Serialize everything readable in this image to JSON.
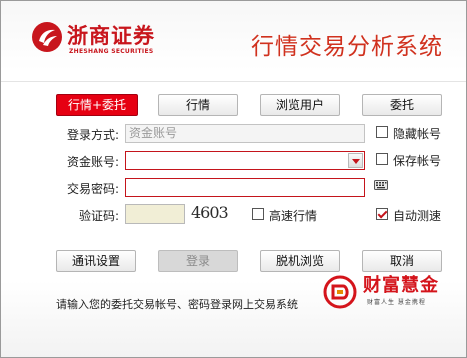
{
  "header": {
    "logo_name": "浙商证券",
    "logo_en": "ZHESHANG SECURITIES",
    "app_title": "行情交易分析系统"
  },
  "modes": [
    "行情+委托",
    "行情",
    "浏览用户",
    "委托"
  ],
  "form": {
    "login_mode_label": "登录方式:",
    "login_mode_value": "资金账号",
    "account_label": "资金账号:",
    "account_value": "",
    "password_label": "交易密码:",
    "password_value": "",
    "captcha_label": "验证码:",
    "captcha_value": "",
    "captcha_image_text": "4603"
  },
  "options": {
    "hide_account": "隐藏帐号",
    "save_account": "保存帐号",
    "fast_quotes": "高速行情",
    "auto_speedtest": "自动测速"
  },
  "buttons": {
    "comm_settings": "通讯设置",
    "login": "登录",
    "offline_browse": "脱机浏览",
    "cancel": "取消"
  },
  "hint": "请输入您的委托交易帐号、密码登录网上交易系统",
  "brand": {
    "name": "财富慧金",
    "tagline": "财富人生 慧金携程"
  },
  "colors": {
    "accent": "#e60012",
    "brand_red": "#c8161d"
  }
}
